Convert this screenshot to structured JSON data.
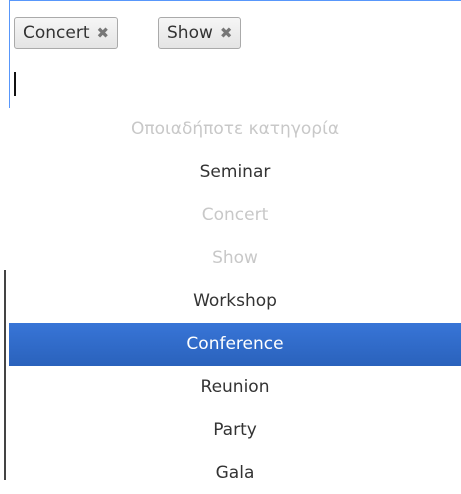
{
  "selected_chips": [
    {
      "label": "Concert",
      "remove_glyph": "✖"
    },
    {
      "label": "Show",
      "remove_glyph": "✖"
    }
  ],
  "search": {
    "value": "",
    "placeholder": ""
  },
  "options": [
    {
      "label": "Οποιαδήποτε κατηγορία",
      "state": "disabled"
    },
    {
      "label": "Seminar",
      "state": "enabled"
    },
    {
      "label": "Concert",
      "state": "disabled"
    },
    {
      "label": "Show",
      "state": "disabled"
    },
    {
      "label": "Workshop",
      "state": "enabled"
    },
    {
      "label": "Conference",
      "state": "highlighted"
    },
    {
      "label": "Reunion",
      "state": "enabled"
    },
    {
      "label": "Party",
      "state": "enabled"
    },
    {
      "label": "Gala",
      "state": "enabled"
    }
  ],
  "colors": {
    "focus_border": "#5897fb",
    "highlight": "#3875d7",
    "disabled_text": "#c8c8c8",
    "text": "#333333"
  }
}
